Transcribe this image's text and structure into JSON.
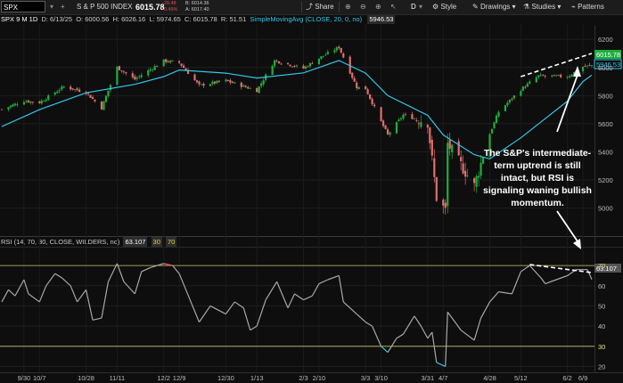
{
  "toolbar": {
    "symbol": "SPX",
    "index_name": "S & P 500 INDEX",
    "last": "6015.78",
    "change_top": "-29.48",
    "change_bottom": "-0.49%",
    "bid_top": "B: 6014.36",
    "ask_bottom": "A: 6017.40",
    "share": "Share",
    "interval": "D",
    "style": "Style",
    "drawings": "Drawings",
    "studies": "Studies",
    "patterns": "Patterns"
  },
  "info": {
    "aggregation": "SPX 9 M 1D",
    "date": "D: 6/13/25",
    "open": "O: 6000.56",
    "high": "H: 6026.16",
    "low": "L: 5974.65",
    "close": "C: 6015.78",
    "range": "R: 51.51",
    "sma_label": "SimpleMovingAvg (CLOSE, 20, 0, no)",
    "sma_value": "5946.53"
  },
  "rsi": {
    "label": "RSI (14, 70, 30, CLOSE, WILDERS, no)",
    "value": "63.107",
    "levels_label": [
      "30",
      "70"
    ]
  },
  "annotation": {
    "line1": "The S&P's intermediate-",
    "line2": "term uptrend is still",
    "line3": "intact, but RSI is",
    "line4": "signaling waning bullish",
    "line5": "momentum."
  },
  "colors": {
    "background": "#0e0e0e",
    "up_candle": "#1fae3e",
    "down_candle": "#e06e6e",
    "sma": "#34c6e8",
    "rsi_line": "#a8a8a8",
    "rsi_overbought": "#ff5a5a",
    "rsi_oversold": "#34c6e8",
    "level_line": "#c8c36a",
    "price_tag": "#1fae3e"
  },
  "chart_data": [
    {
      "type": "candlestick",
      "title": "SPX 9 M 1D",
      "x_ticks": [
        "9/30",
        "10/7",
        "10/28",
        "11/11",
        "12/2",
        "12/9",
        "12/30",
        "1/13",
        "2/3",
        "2/10",
        "3/3",
        "3/10",
        "3/31",
        "4/7",
        "4/28",
        "5/12",
        "6/2",
        "6/9"
      ],
      "y_ticks": [
        5000,
        5200,
        5400,
        5600,
        5800,
        6000,
        6200
      ],
      "ylim": [
        4820,
        6290
      ],
      "last_price_tag": 6015.78,
      "sma_tag": 5946.53,
      "close_path": [
        [
          "9/20",
          5702
        ],
        [
          "9/30",
          5762
        ],
        [
          "10/7",
          5751
        ],
        [
          "10/18",
          5864
        ],
        [
          "10/28",
          5823
        ],
        [
          "11/4",
          5712
        ],
        [
          "11/11",
          6001
        ],
        [
          "11/19",
          5916
        ],
        [
          "12/2",
          6047
        ],
        [
          "12/9",
          6034
        ],
        [
          "12/18",
          5872
        ],
        [
          "12/30",
          5906
        ],
        [
          "1/13",
          5836
        ],
        [
          "1/21",
          6049
        ],
        [
          "2/3",
          5994
        ],
        [
          "2/10",
          6066
        ],
        [
          "2/19",
          6144
        ],
        [
          "2/27",
          5861
        ],
        [
          "3/3",
          5849
        ],
        [
          "3/10",
          5614
        ],
        [
          "3/13",
          5521
        ],
        [
          "3/20",
          5662
        ],
        [
          "3/31",
          5611
        ],
        [
          "4/4",
          5074
        ],
        [
          "4/8",
          4982
        ],
        [
          "4/9",
          5457
        ],
        [
          "4/21",
          5158
        ],
        [
          "4/28",
          5528
        ],
        [
          "5/2",
          5686
        ],
        [
          "5/12",
          5844
        ],
        [
          "5/20",
          5940
        ],
        [
          "6/2",
          5935
        ],
        [
          "6/9",
          6005
        ],
        [
          "6/13",
          6015
        ]
      ],
      "sma20_path": [
        [
          "9/20",
          5580
        ],
        [
          "10/7",
          5700
        ],
        [
          "10/28",
          5820
        ],
        [
          "11/19",
          5880
        ],
        [
          "12/2",
          5935
        ],
        [
          "12/9",
          5982
        ],
        [
          "12/30",
          5960
        ],
        [
          "1/13",
          5925
        ],
        [
          "2/3",
          5962
        ],
        [
          "2/10",
          6000
        ],
        [
          "2/19",
          6050
        ],
        [
          "3/3",
          5960
        ],
        [
          "3/13",
          5800
        ],
        [
          "3/31",
          5660
        ],
        [
          "4/7",
          5520
        ],
        [
          "4/21",
          5380
        ],
        [
          "4/28",
          5350
        ],
        [
          "5/12",
          5500
        ],
        [
          "6/2",
          5760
        ],
        [
          "6/9",
          5900
        ],
        [
          "6/13",
          5946
        ]
      ],
      "trendline": [
        [
          "5/12",
          5935
        ],
        [
          "6/13",
          6100
        ]
      ]
    },
    {
      "type": "line",
      "title": "RSI (14, 70, 30, CLOSE, WILDERS, no)",
      "ylim": [
        18,
        78
      ],
      "y_ticks": [
        20,
        30,
        40,
        50,
        60,
        70
      ],
      "levels": [
        30,
        70
      ],
      "last_value": 63.107,
      "series": [
        {
          "values": [
            [
              "9/20",
              52
            ],
            [
              "9/23",
              58
            ],
            [
              "9/26",
              55
            ],
            [
              "9/30",
              63
            ],
            [
              "10/2",
              56
            ],
            [
              "10/7",
              52
            ],
            [
              "10/10",
              60
            ],
            [
              "10/14",
              66
            ],
            [
              "10/17",
              64
            ],
            [
              "10/21",
              60
            ],
            [
              "10/24",
              52
            ],
            [
              "10/28",
              58
            ],
            [
              "10/31",
              43
            ],
            [
              "11/4",
              44
            ],
            [
              "11/7",
              62
            ],
            [
              "11/11",
              71
            ],
            [
              "11/14",
              62
            ],
            [
              "11/19",
              56
            ],
            [
              "11/22",
              67
            ],
            [
              "11/26",
              69
            ],
            [
              "12/2",
              71
            ],
            [
              "12/6",
              70
            ],
            [
              "12/9",
              66
            ],
            [
              "12/12",
              58
            ],
            [
              "12/18",
              42
            ],
            [
              "12/23",
              50
            ],
            [
              "12/30",
              46
            ],
            [
              "1/3",
              52
            ],
            [
              "1/7",
              49
            ],
            [
              "1/10",
              38
            ],
            [
              "1/13",
              40
            ],
            [
              "1/17",
              53
            ],
            [
              "1/22",
              62
            ],
            [
              "1/27",
              49
            ],
            [
              "1/30",
              56
            ],
            [
              "2/3",
              53
            ],
            [
              "2/7",
              55
            ],
            [
              "2/10",
              61
            ],
            [
              "2/14",
              63
            ],
            [
              "2/19",
              65
            ],
            [
              "2/21",
              52
            ],
            [
              "2/27",
              46
            ],
            [
              "3/3",
              42
            ],
            [
              "3/6",
              40
            ],
            [
              "3/10",
              30
            ],
            [
              "3/13",
              27
            ],
            [
              "3/17",
              34
            ],
            [
              "3/20",
              36
            ],
            [
              "3/25",
              45
            ],
            [
              "3/28",
              40
            ],
            [
              "3/31",
              34
            ],
            [
              "4/2",
              37
            ],
            [
              "4/4",
              22
            ],
            [
              "4/8",
              20
            ],
            [
              "4/9",
              47
            ],
            [
              "4/15",
              38
            ],
            [
              "4/21",
              33
            ],
            [
              "4/24",
              44
            ],
            [
              "4/28",
              52
            ],
            [
              "5/2",
              57
            ],
            [
              "5/8",
              56
            ],
            [
              "5/12",
              67
            ],
            [
              "5/16",
              70
            ],
            [
              "5/21",
              64
            ],
            [
              "5/23",
              61
            ],
            [
              "5/28",
              63
            ],
            [
              "6/2",
              65
            ],
            [
              "6/6",
              68
            ],
            [
              "6/11",
              68
            ],
            [
              "6/13",
              63.107
            ]
          ]
        }
      ],
      "trendline": [
        [
          "5/16",
          70.5
        ],
        [
          "6/13",
          66.5
        ]
      ]
    }
  ]
}
